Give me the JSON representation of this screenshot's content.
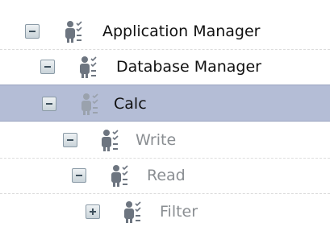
{
  "tree": {
    "nodes": [
      {
        "label": "Application Manager",
        "expanded": true,
        "selected": false,
        "enabled": true,
        "icon": "role-users-icon",
        "toggle_icon": "collapse-icon"
      },
      {
        "label": "Database Manager",
        "expanded": true,
        "selected": false,
        "enabled": true,
        "icon": "role-users-icon",
        "toggle_icon": "collapse-icon"
      },
      {
        "label": "Calc",
        "expanded": true,
        "selected": true,
        "enabled": true,
        "icon": "role-users-icon",
        "toggle_icon": "collapse-icon"
      },
      {
        "label": "Write",
        "expanded": true,
        "selected": false,
        "enabled": false,
        "icon": "role-users-icon",
        "toggle_icon": "collapse-icon"
      },
      {
        "label": "Read",
        "expanded": true,
        "selected": false,
        "enabled": false,
        "icon": "role-users-icon",
        "toggle_icon": "collapse-icon"
      },
      {
        "label": "Filter",
        "expanded": false,
        "selected": false,
        "enabled": false,
        "icon": "role-users-icon",
        "toggle_icon": "expand-icon"
      }
    ]
  },
  "colors": {
    "selection": "#b4bdd6",
    "text": "#111111",
    "disabled_text": "#8a8e92"
  }
}
